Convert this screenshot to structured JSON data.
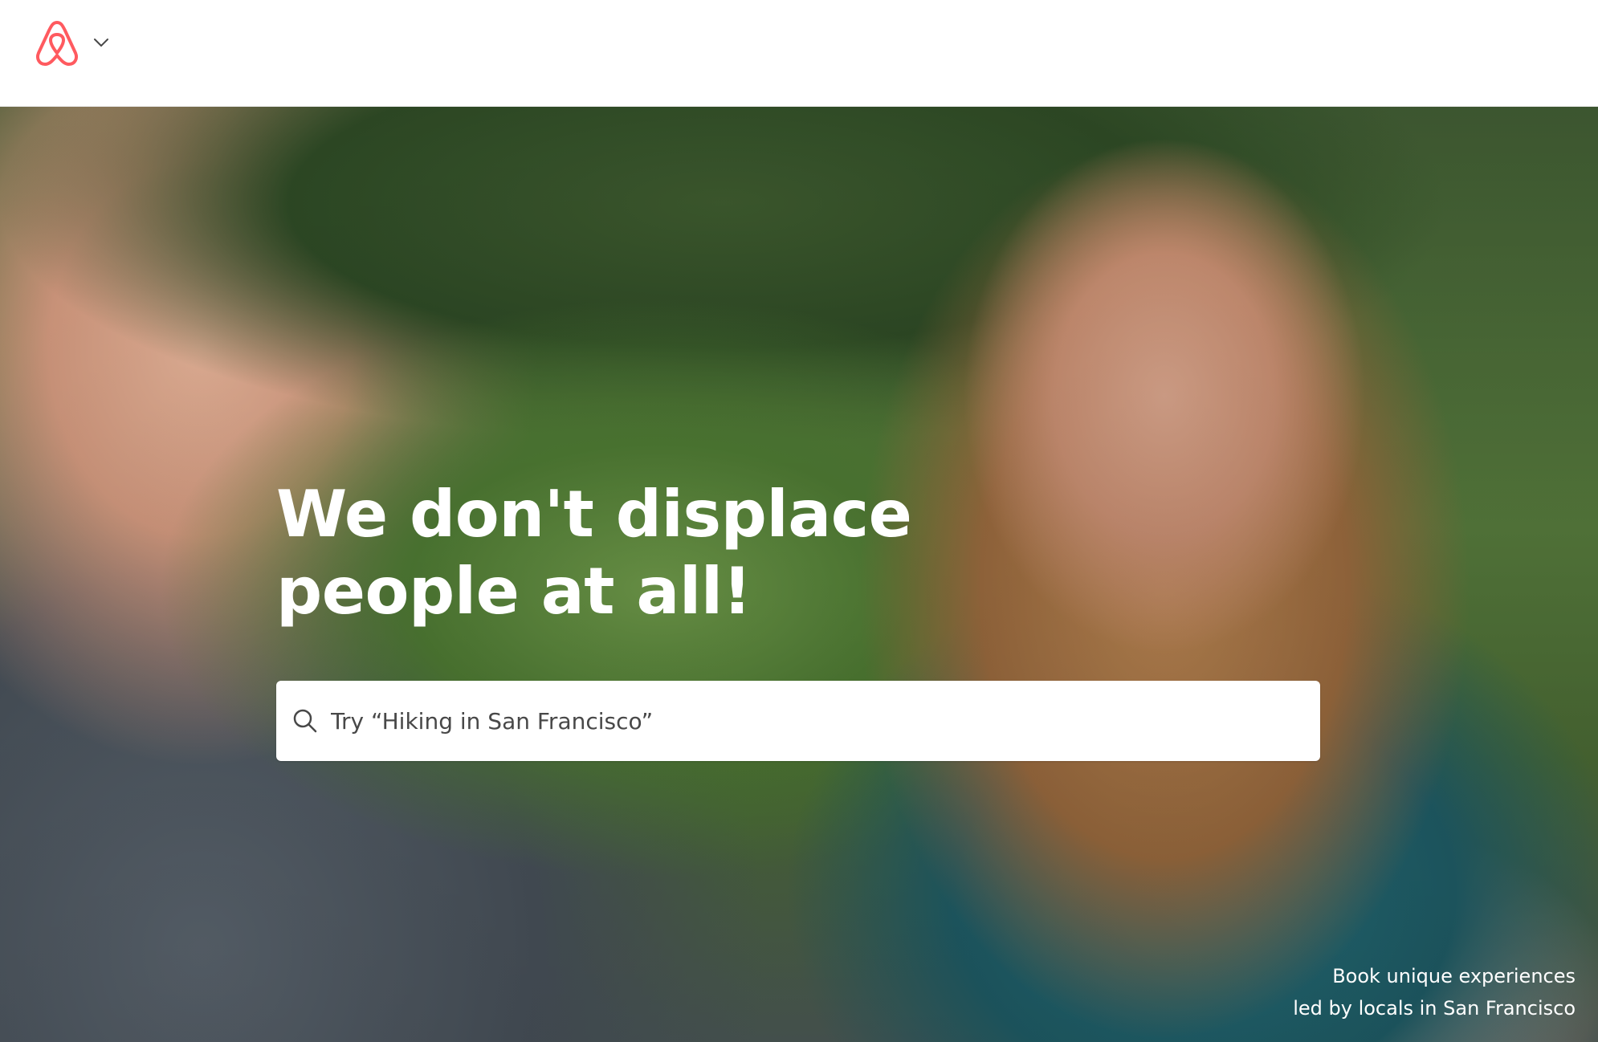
{
  "header": {
    "logo_icon": "airbnb-belo-icon",
    "menu_icon": "chevron-down-icon",
    "brand_color": "#FF5A5F"
  },
  "hero": {
    "headline": "We don't displace people at all!",
    "search": {
      "placeholder": "Try “Hiking in San Francisco”",
      "icon": "search-icon"
    },
    "caption_line1": "Book unique experiences",
    "caption_line2": "led by locals in San Francisco"
  }
}
